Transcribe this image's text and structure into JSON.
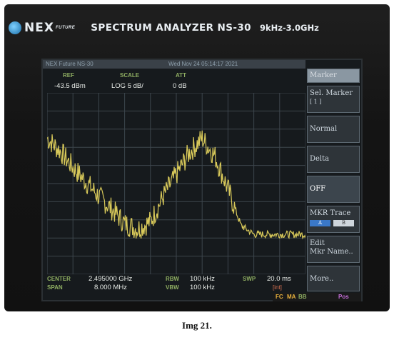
{
  "brand": {
    "logo": "NEX",
    "logo_sub": "FUTURE",
    "title": "SPECTRUM ANALYZER NS-30",
    "freq_range": "9kHz-3.0GHz"
  },
  "header": {
    "left": "NEX Future NS-30",
    "date": "Wed Nov 24 05:14:17 2021"
  },
  "params": {
    "ref_label": "REF",
    "ref_value": "-43.5 dBm",
    "scale_label": "SCALE",
    "scale_value": "LOG  5 dB/",
    "att_label": "ATT",
    "att_value": "0 dB"
  },
  "bottom": {
    "center_label": "CENTER",
    "center_value": "2.495000 GHz",
    "span_label": "SPAN",
    "span_value": "8.000 MHz",
    "rbw_label": "RBW",
    "rbw_value": "100 kHz",
    "vbw_label": "VBW",
    "vbw_value": "100 kHz",
    "swp_label": "SWP",
    "swp_value": "20.0 ms",
    "int_label": "[int]"
  },
  "softkeys": {
    "title": "Marker",
    "sel_marker": "Sel. Marker",
    "sel_marker_sub": "[ 1 ]",
    "normal": "Normal",
    "delta": "Delta",
    "off": "OFF",
    "mkr_trace": "MKR Trace",
    "mkr_trace_a": "A",
    "mkr_trace_b": "B",
    "edit": "Edit",
    "mkr_name": "Mkr Name..",
    "more": "More.."
  },
  "status": {
    "fc": "FC",
    "ma": "MA",
    "bb": "BB",
    "pos": "Pos",
    "fc_color": "#e8b13c",
    "ma_color": "#e8b13c",
    "bb_color": "#8fae62",
    "pos_color": "#c46ed8"
  },
  "caption": "Img 21.",
  "chart_data": {
    "type": "line",
    "title": "",
    "xlabel": "",
    "ylabel": "",
    "trace_color": "#d8c95a",
    "x_divisions": 10,
    "y_divisions": 10,
    "xlim": [
      2.491,
      2.499
    ],
    "ylim": [
      -93.5,
      -43.5
    ],
    "x": [
      2.491,
      2.4914,
      2.4918,
      2.4922,
      2.4926,
      2.493,
      2.4934,
      2.4938,
      2.4942,
      2.4946,
      2.495,
      2.4954,
      2.4958,
      2.4962,
      2.4966,
      2.497,
      2.4974,
      2.4978,
      2.4982,
      2.4986,
      2.499
    ],
    "series": [
      {
        "values": [
          -56.0,
          -59.5,
          -64.0,
          -68.0,
          -72.0,
          -75.5,
          -79.5,
          -81.0,
          -79.0,
          -72.0,
          -66.0,
          -60.0,
          -56.0,
          -61.0,
          -70.0,
          -80.0,
          -82.5,
          -82.5,
          -82.5,
          -82.5,
          -82.5
        ]
      }
    ]
  }
}
